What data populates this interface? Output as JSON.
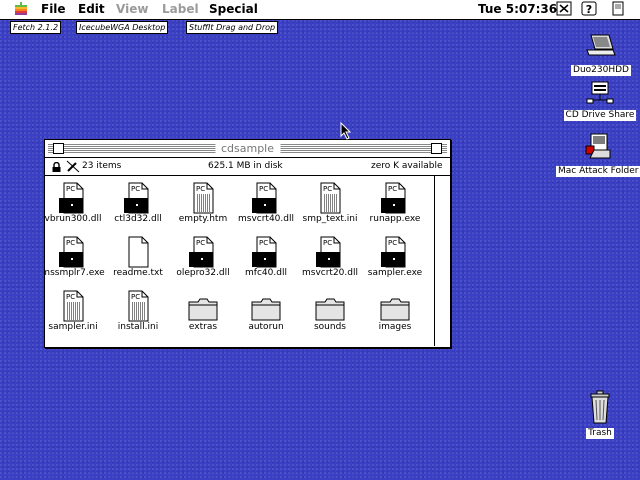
{
  "menubar": {
    "items": [
      {
        "label": "File",
        "enabled": true
      },
      {
        "label": "Edit",
        "enabled": true
      },
      {
        "label": "View",
        "enabled": false
      },
      {
        "label": "Label",
        "enabled": false
      },
      {
        "label": "Special",
        "enabled": true
      }
    ],
    "clock": "Tue 5:07:36"
  },
  "strip": [
    "Fetch 2.1.2",
    "IcecubeWGA Desktop",
    "StuffIt Drag and Drop"
  ],
  "desktop": {
    "icons": [
      {
        "label": "Duo230HDD",
        "icon": "laptop-icon"
      },
      {
        "label": "CD Drive Share",
        "icon": "cd-share-icon"
      },
      {
        "label": "Mac Attack Folder",
        "icon": "mac-attack-icon"
      },
      {
        "label": "Trash",
        "icon": "trash-icon"
      }
    ]
  },
  "window": {
    "title": "cdsample",
    "info": {
      "items": "23 items",
      "disk": "625.1 MB in disk",
      "available": "zero K available"
    },
    "files": [
      {
        "name": "vbrun300.dll",
        "icon": "pc-dll-icon"
      },
      {
        "name": "ctl3d32.dll",
        "icon": "pc-dll-icon"
      },
      {
        "name": "empty.htm",
        "icon": "pc-text-icon"
      },
      {
        "name": "msvcrt40.dll",
        "icon": "pc-dll-icon"
      },
      {
        "name": "smp_text.ini",
        "icon": "pc-text-icon"
      },
      {
        "name": "runapp.exe",
        "icon": "pc-dll-icon"
      },
      {
        "name": "mssmplr7.exe",
        "icon": "pc-dll-icon"
      },
      {
        "name": "readme.txt",
        "icon": "blank-doc-icon"
      },
      {
        "name": "olepro32.dll",
        "icon": "pc-dll-icon"
      },
      {
        "name": "mfc40.dll",
        "icon": "pc-dll-icon"
      },
      {
        "name": "msvcrt20.dll",
        "icon": "pc-dll-icon"
      },
      {
        "name": "sampler.exe",
        "icon": "pc-dll-icon"
      },
      {
        "name": "sampler.ini",
        "icon": "pc-text-icon"
      },
      {
        "name": "install.ini",
        "icon": "pc-text-icon"
      },
      {
        "name": "extras",
        "icon": "folder-icon"
      },
      {
        "name": "autorun",
        "icon": "folder-icon"
      },
      {
        "name": "sounds",
        "icon": "folder-icon"
      },
      {
        "name": "images",
        "icon": "folder-icon"
      }
    ]
  }
}
